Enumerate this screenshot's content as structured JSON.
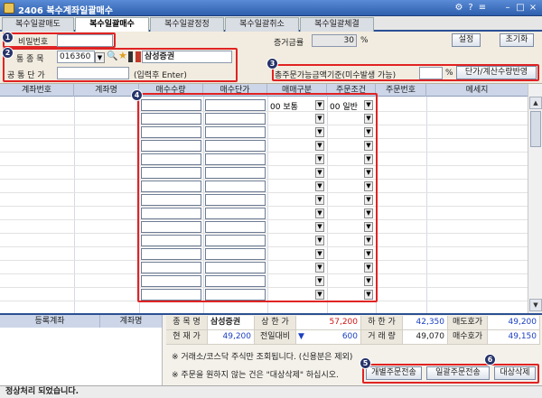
{
  "window": {
    "title": "2406 복수계좌일괄매수",
    "controls": [
      "⚙",
      "?",
      "≡",
      "–",
      "□",
      "×"
    ]
  },
  "tabs": [
    {
      "label": "복수일괄매도",
      "active": false
    },
    {
      "label": "복수일괄매수",
      "active": true
    },
    {
      "label": "복수일괄정정",
      "active": false
    },
    {
      "label": "복수일괄취소",
      "active": false
    },
    {
      "label": "복수일괄체결",
      "active": false
    }
  ],
  "form": {
    "password_label": "비밀번호",
    "stock_label": "통 종 목",
    "stock_code": "016360",
    "stock_name": "삼성증권",
    "price_label": "공 통 단 가",
    "price_hint": "(입력후 Enter)",
    "margin_label": "증거금률",
    "margin_value": "30",
    "percent": "%",
    "settings_button": "설정",
    "reset_button": "초기화",
    "order_basis_label": "총주문가능금액기준(미수발생 가능)",
    "apply_button": "단가/계산수량반영"
  },
  "grid": {
    "headers": [
      "계좌번호",
      "계좌명",
      "매수수량",
      "매수단가",
      "매매구분",
      "주문조건",
      "주문번호",
      "메세지"
    ],
    "first_row": {
      "trade_type": "00 보통",
      "order_condition": "00 일반"
    },
    "row_count": 15
  },
  "accounts_panel": {
    "header_account": "등록계좌",
    "header_name": "계좌명"
  },
  "quote": {
    "name_label": "종 목 명",
    "name_value": "삼성증권",
    "upper_label": "상 한 가",
    "upper_value": "57,200",
    "lower_label": "하 한 가",
    "lower_value": "42,350",
    "ask_label": "매도호가",
    "ask_value": "49,200",
    "current_label": "현 재 가",
    "current_value": "49,200",
    "change_label": "전일대비",
    "change_value": "600",
    "change_arrow": "▼",
    "volume_label": "거 래 량",
    "volume_value": "49,070",
    "bid_label": "매수호가",
    "bid_value": "49,150"
  },
  "notes": [
    "※ 거래소/코스닥 주식만 조회됩니다. (신용분은 제외)",
    "※ 주문을 원하지 않는 건은 \"대상삭제\" 하십시오."
  ],
  "actions": {
    "individual_order": "개별주문전송",
    "batch_order": "일괄주문전송",
    "delete_target": "대상삭제"
  },
  "status": "정상처리 되었습니다.",
  "badges": [
    "1",
    "2",
    "3",
    "4",
    "5",
    "6"
  ],
  "colors": {
    "accent": "#2b4f93",
    "highlight": "#e02323",
    "up": "#d21414",
    "down": "#1c3fc0"
  }
}
